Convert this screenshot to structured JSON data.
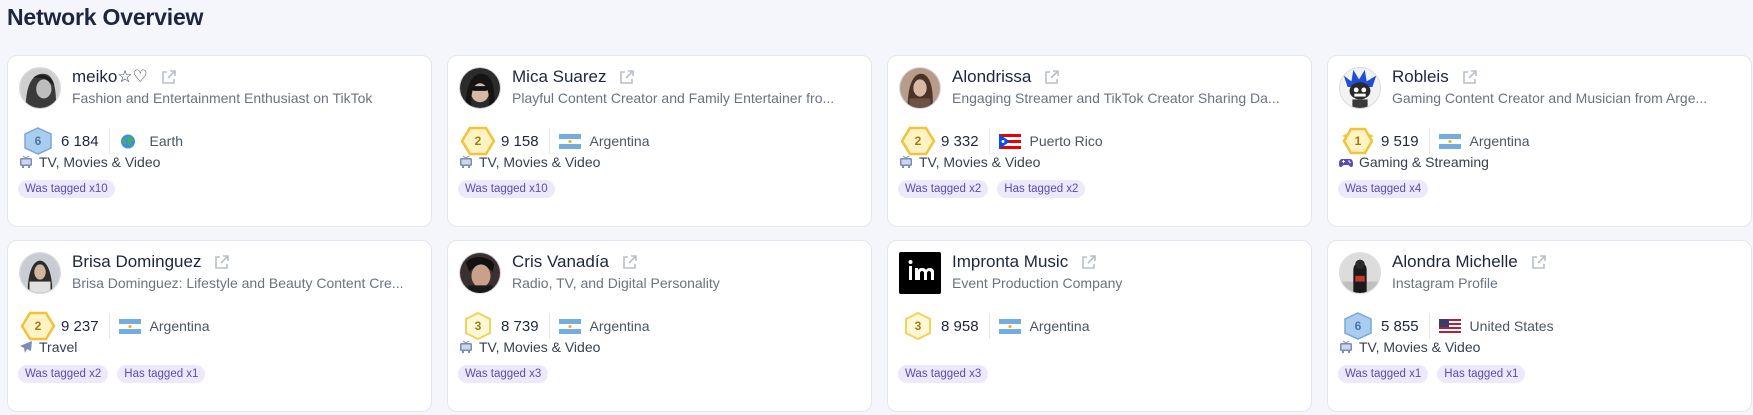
{
  "header": {
    "title": "Network Overview"
  },
  "cards": [
    {
      "name": "meiko☆♡",
      "description": "Fashion and Entertainment Enthusiast on TikTok",
      "rank": "6",
      "score": "6 184",
      "location": "Earth",
      "location_icon": "globe-icon",
      "category": "TV, Movies & Video",
      "category_icon": "tv-icon",
      "tags": [
        "Was tagged x10"
      ]
    },
    {
      "name": "Mica Suarez",
      "description": "Playful Content Creator and Family Entertainer fro...",
      "rank": "2",
      "score": "9 158",
      "location": "Argentina",
      "location_icon": "argentina-flag-icon",
      "category": "TV, Movies & Video",
      "category_icon": "tv-icon",
      "tags": [
        "Was tagged x10"
      ]
    },
    {
      "name": "Alondrissa",
      "description": "Engaging Streamer and TikTok Creator Sharing Da...",
      "rank": "2",
      "score": "9 332",
      "location": "Puerto Rico",
      "location_icon": "puerto-rico-flag-icon",
      "category": "TV, Movies & Video",
      "category_icon": "tv-icon",
      "tags": [
        "Was tagged x2",
        "Has tagged x2"
      ]
    },
    {
      "name": "Robleis",
      "description": "Gaming Content Creator and Musician from Arge...",
      "rank": "1",
      "score": "9 519",
      "location": "Argentina",
      "location_icon": "argentina-flag-icon",
      "category": "Gaming & Streaming",
      "category_icon": "gamepad-icon",
      "tags": [
        "Was tagged x4"
      ]
    },
    {
      "name": "Brisa Dominguez",
      "description": "Brisa Dominguez: Lifestyle and Beauty Content Cre...",
      "rank": "2",
      "score": "9 237",
      "location": "Argentina",
      "location_icon": "argentina-flag-icon",
      "category": "Travel",
      "category_icon": "airplane-icon",
      "tags": [
        "Was tagged x2",
        "Has tagged x1"
      ]
    },
    {
      "name": "Cris Vanadía",
      "description": "Radio, TV, and Digital Personality",
      "rank": "3",
      "score": "8 739",
      "location": "Argentina",
      "location_icon": "argentina-flag-icon",
      "category": "TV, Movies & Video",
      "category_icon": "tv-icon",
      "tags": [
        "Was tagged x3"
      ]
    },
    {
      "name": "Impronta Music",
      "description": "Event Production Company",
      "rank": "3",
      "score": "8 958",
      "location": "Argentina",
      "location_icon": "argentina-flag-icon",
      "category": "",
      "category_icon": "",
      "tags": [
        "Was tagged x3"
      ]
    },
    {
      "name": "Alondra Michelle",
      "description": "Instagram Profile",
      "rank": "6",
      "score": "5 855",
      "location": "United States",
      "location_icon": "usa-flag-icon",
      "category": "TV, Movies & Video",
      "category_icon": "tv-icon",
      "tags": [
        "Was tagged x1",
        "Has tagged x1"
      ]
    }
  ],
  "colors": {
    "rank_1_2": "#f5c842",
    "rank_3": "#f2d25c",
    "rank_6": "#9fc3e8",
    "tag_bg": "#ede9fb",
    "tag_text": "#5b4bb5"
  }
}
